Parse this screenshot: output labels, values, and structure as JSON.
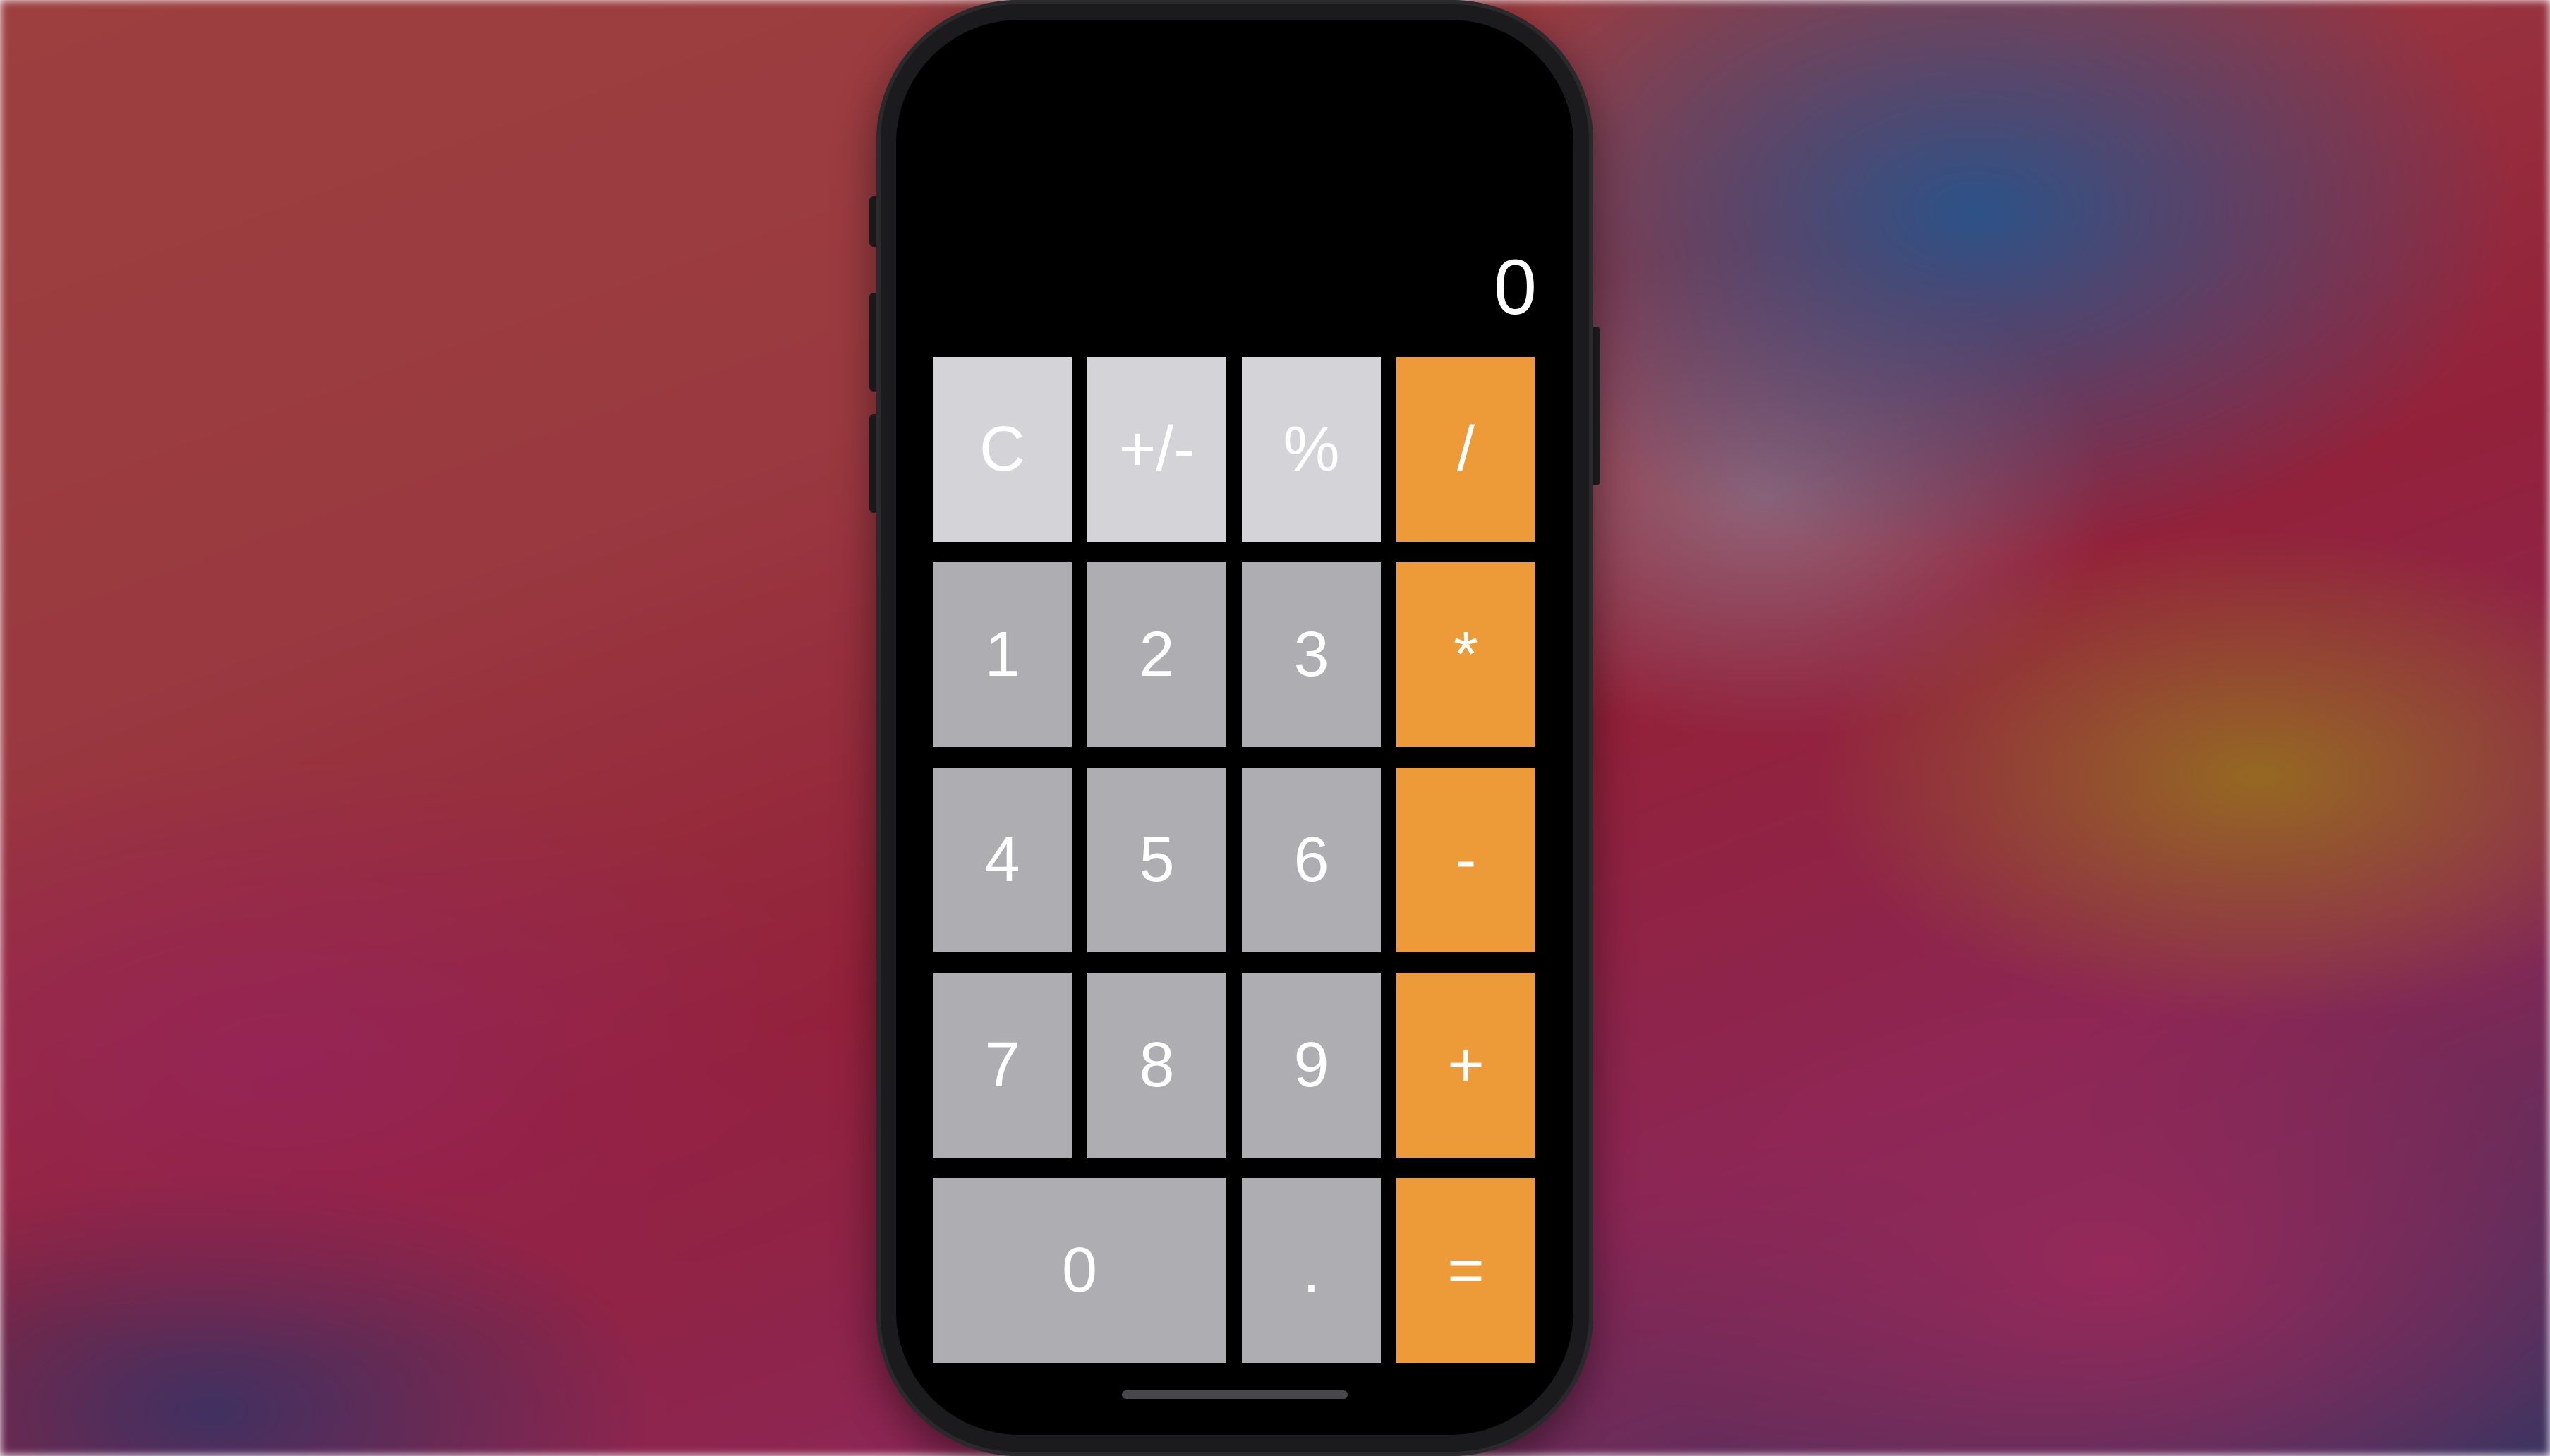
{
  "app": {
    "display_value": "0"
  },
  "colors": {
    "function_key": "#d4d4d8",
    "number_key": "#aeaeb2",
    "operator_key": "#ed9a38",
    "screen_background": "#000000"
  },
  "keys": {
    "clear": "C",
    "sign": "+/-",
    "percent": "%",
    "divide": "/",
    "one": "1",
    "two": "2",
    "three": "3",
    "multiply": "*",
    "four": "4",
    "five": "5",
    "six": "6",
    "subtract": "-",
    "seven": "7",
    "eight": "8",
    "nine": "9",
    "add": "+",
    "zero": "0",
    "decimal": ".",
    "equals": "="
  }
}
